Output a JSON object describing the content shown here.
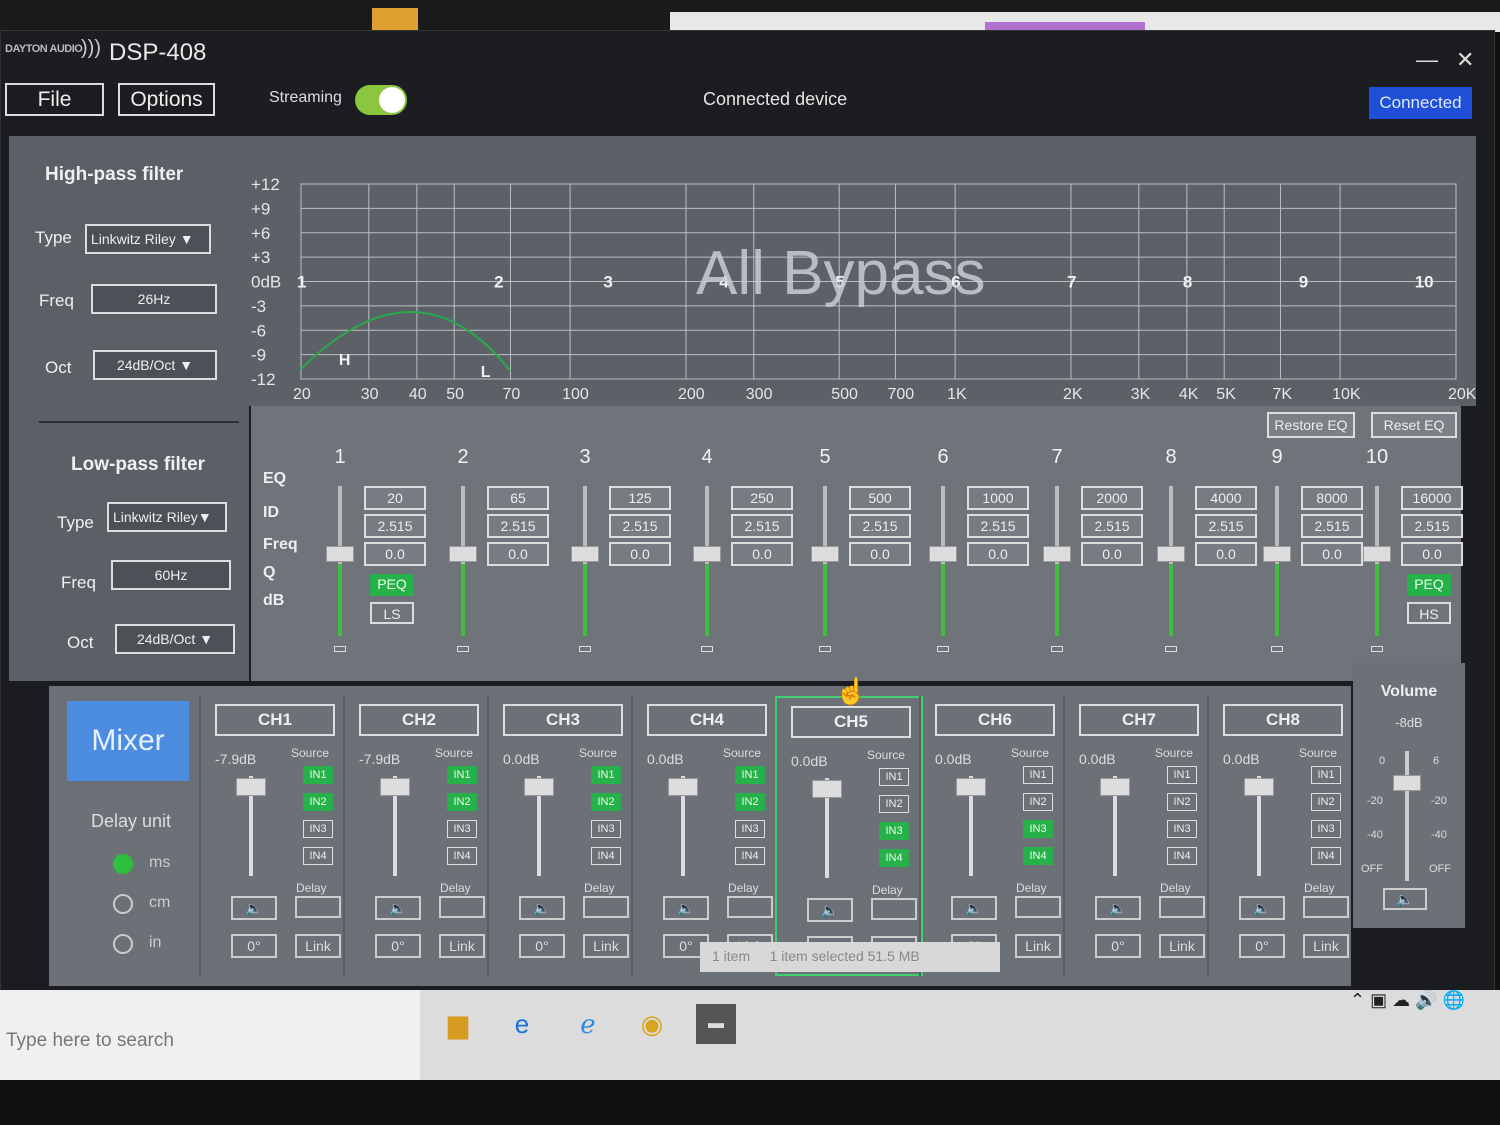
{
  "app": {
    "brand": "DAYTON AUDIO",
    "title": "DSP-408",
    "minimize": "—",
    "close": "✕"
  },
  "menu": {
    "file": "File",
    "options": "Options",
    "streaming_label": "Streaming",
    "streaming_on": true,
    "device_label": "Connected device",
    "status": "Connected"
  },
  "highpass": {
    "title": "High-pass filter",
    "type_label": "Type",
    "type_value": "Linkwitz Riley",
    "freq_label": "Freq",
    "freq_value": "26Hz",
    "oct_label": "Oct",
    "oct_value": "24dB/Oct"
  },
  "lowpass": {
    "title": "Low-pass filter",
    "type_label": "Type",
    "type_value": "Linkwitz Riley",
    "freq_label": "Freq",
    "freq_value": "60Hz",
    "oct_label": "Oct",
    "oct_value": "24dB/Oct"
  },
  "graph": {
    "overlay": "All Bypass",
    "y_ticks": [
      "+12",
      "+9",
      "+6",
      "+3",
      "0dB",
      "-3",
      "-6",
      "-9",
      "-12"
    ],
    "x_ticks": [
      "20",
      "30",
      "40",
      "50",
      "70",
      "100",
      "200",
      "300",
      "500",
      "700",
      "1K",
      "2K",
      "3K",
      "4K",
      "5K",
      "7K",
      "10K",
      "20K"
    ],
    "band_markers": [
      "1",
      "2",
      "3",
      "4",
      "5",
      "6",
      "7",
      "8",
      "9",
      "10"
    ],
    "hp_marker": "H",
    "lp_marker": "L"
  },
  "eq": {
    "restore": "Restore EQ",
    "reset": "Reset EQ",
    "labels": [
      "EQ",
      "ID",
      "Freq",
      "Q",
      "dB"
    ],
    "bands": [
      {
        "id": "1",
        "freq": "20",
        "q": "2.515",
        "db": "0.0",
        "type": "PEQ",
        "shelf": "LS"
      },
      {
        "id": "2",
        "freq": "65",
        "q": "2.515",
        "db": "0.0",
        "type": "",
        "shelf": ""
      },
      {
        "id": "3",
        "freq": "125",
        "q": "2.515",
        "db": "0.0",
        "type": "",
        "shelf": ""
      },
      {
        "id": "4",
        "freq": "250",
        "q": "2.515",
        "db": "0.0",
        "type": "",
        "shelf": ""
      },
      {
        "id": "5",
        "freq": "500",
        "q": "2.515",
        "db": "0.0",
        "type": "",
        "shelf": ""
      },
      {
        "id": "6",
        "freq": "1000",
        "q": "2.515",
        "db": "0.0",
        "type": "",
        "shelf": ""
      },
      {
        "id": "7",
        "freq": "2000",
        "q": "2.515",
        "db": "0.0",
        "type": "",
        "shelf": ""
      },
      {
        "id": "8",
        "freq": "4000",
        "q": "2.515",
        "db": "0.0",
        "type": "",
        "shelf": ""
      },
      {
        "id": "9",
        "freq": "8000",
        "q": "2.515",
        "db": "0.0",
        "type": "",
        "shelf": ""
      },
      {
        "id": "10",
        "freq": "16000",
        "q": "2.515",
        "db": "0.0",
        "type": "PEQ",
        "shelf": "HS"
      }
    ]
  },
  "mixer": {
    "button": "Mixer",
    "delay_unit": "Delay unit",
    "units": [
      "ms",
      "cm",
      "in"
    ],
    "source_label": "Source",
    "delay_label": "Delay",
    "phase": "0°",
    "link": "Link",
    "inputs": [
      "IN1",
      "IN2",
      "IN3",
      "IN4"
    ],
    "channels": [
      {
        "name": "CH1",
        "gain": "-7.9dB",
        "active": [
          true,
          true,
          false,
          false
        ]
      },
      {
        "name": "CH2",
        "gain": "-7.9dB",
        "active": [
          true,
          true,
          false,
          false
        ]
      },
      {
        "name": "CH3",
        "gain": "0.0dB",
        "active": [
          true,
          true,
          false,
          false
        ]
      },
      {
        "name": "CH4",
        "gain": "0.0dB",
        "active": [
          true,
          true,
          false,
          false
        ]
      },
      {
        "name": "CH5",
        "gain": "0.0dB",
        "active": [
          false,
          false,
          true,
          true
        ]
      },
      {
        "name": "CH6",
        "gain": "0.0dB",
        "active": [
          false,
          false,
          true,
          true
        ]
      },
      {
        "name": "CH7",
        "gain": "0.0dB",
        "active": [
          false,
          false,
          false,
          false
        ]
      },
      {
        "name": "CH8",
        "gain": "0.0dB",
        "active": [
          false,
          false,
          false,
          false
        ]
      }
    ]
  },
  "volume": {
    "title": "Volume",
    "value": "-8dB",
    "marks_left": [
      "0",
      "-20",
      "-40",
      "OFF"
    ],
    "marks_right": [
      "6",
      "-20",
      "-40",
      "OFF"
    ]
  },
  "explorer_status": {
    "items": "1 item",
    "selected": "1 item selected  51.5 MB"
  },
  "taskbar": {
    "search": "Type here to search"
  }
}
